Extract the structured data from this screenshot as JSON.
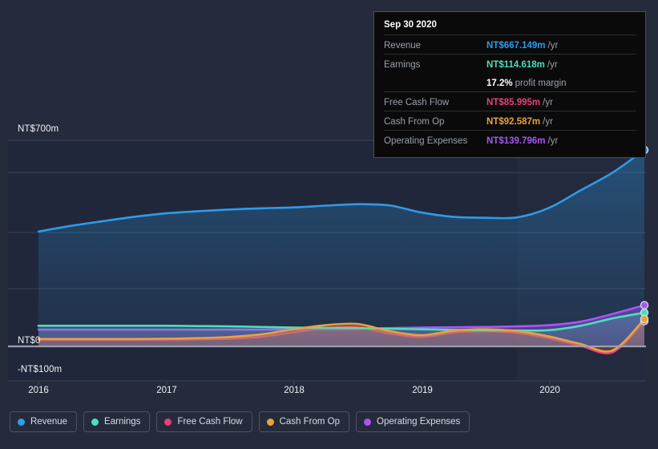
{
  "chart_data": {
    "type": "area",
    "title": "",
    "xlabel": "",
    "ylabel": "",
    "currency": "NT$",
    "grid": true,
    "legend_position": "bottom",
    "ylim": [
      -100,
      700
    ],
    "y_ticks": [
      {
        "label": "NT$700m",
        "value": 700
      },
      {
        "label": "NT$0",
        "value": 0
      },
      {
        "label": "-NT$100m",
        "value": -100
      }
    ],
    "x_ticks": [
      {
        "label": "2016",
        "value": 2016
      },
      {
        "label": "2017",
        "value": 2017
      },
      {
        "label": "2018",
        "value": 2018
      },
      {
        "label": "2019",
        "value": 2019
      },
      {
        "label": "2020",
        "value": 2020
      }
    ],
    "x": [
      2016.0,
      2016.25,
      2016.5,
      2016.75,
      2017.0,
      2017.25,
      2017.5,
      2017.75,
      2018.0,
      2018.25,
      2018.5,
      2018.75,
      2019.0,
      2019.25,
      2019.5,
      2019.75,
      2020.0,
      2020.25,
      2020.5,
      2020.75
    ],
    "series": [
      {
        "name": "Revenue",
        "color": "#2e9bea",
        "values": [
          390,
          409,
          425,
          440,
          452,
          459,
          465,
          469,
          472,
          478,
          483,
          479,
          455,
          440,
          437,
          438,
          470,
          530,
          590,
          667.149
        ]
      },
      {
        "name": "Earnings",
        "color": "#4adfbc",
        "values": [
          70,
          70,
          70,
          70,
          70,
          69,
          68,
          66,
          64,
          63,
          62,
          60,
          58,
          56,
          55,
          54,
          55,
          70,
          95,
          114.618
        ]
      },
      {
        "name": "Free Cash Flow",
        "color": "#e8407a",
        "values": [
          23,
          23,
          23,
          23,
          23,
          24,
          26,
          33,
          48,
          62,
          66,
          44,
          32,
          47,
          52,
          46,
          28,
          2,
          -20,
          85.995
        ]
      },
      {
        "name": "Cash From Op",
        "color": "#e8a33d",
        "values": [
          25,
          25,
          25,
          25,
          26,
          28,
          32,
          41,
          58,
          72,
          76,
          52,
          38,
          53,
          58,
          52,
          34,
          8,
          -14,
          92.587
        ]
      },
      {
        "name": "Operating Expenses",
        "color": "#a855f7",
        "values": [
          57,
          57,
          57,
          57,
          57,
          57,
          57,
          57,
          58,
          59,
          60,
          62,
          64,
          65,
          66,
          68,
          72,
          84,
          110,
          139.796
        ]
      }
    ]
  },
  "tooltip": {
    "date": "Sep 30 2020",
    "rows": [
      {
        "label": "Revenue",
        "value": "NT$667.149m",
        "unit": "/yr",
        "color": "#2e9bea",
        "rule": true
      },
      {
        "label": "Earnings",
        "value": "NT$114.618m",
        "unit": "/yr",
        "color": "#4adfbc",
        "rule": true
      },
      {
        "label": "",
        "value": "17.2%",
        "unit": "profit margin",
        "color": "#ffffff",
        "rule": false
      },
      {
        "label": "Free Cash Flow",
        "value": "NT$85.995m",
        "unit": "/yr",
        "color": "#e8407a",
        "rule": true
      },
      {
        "label": "Cash From Op",
        "value": "NT$92.587m",
        "unit": "/yr",
        "color": "#e8a33d",
        "rule": true
      },
      {
        "label": "Operating Expenses",
        "value": "NT$139.796m",
        "unit": "/yr",
        "color": "#a855f7",
        "rule": true
      }
    ]
  },
  "legend": {
    "items": [
      {
        "label": "Revenue",
        "color": "#2e9bea"
      },
      {
        "label": "Earnings",
        "color": "#4adfbc"
      },
      {
        "label": "Free Cash Flow",
        "color": "#e8407a"
      },
      {
        "label": "Cash From Op",
        "color": "#e8a33d"
      },
      {
        "label": "Operating Expenses",
        "color": "#a855f7"
      }
    ]
  },
  "theme": {
    "background": "#252b3b",
    "plot_band": "#21273a",
    "gridline": "#3c4356",
    "baseline": "#9aa0ab",
    "text": "#f0f2f5"
  }
}
